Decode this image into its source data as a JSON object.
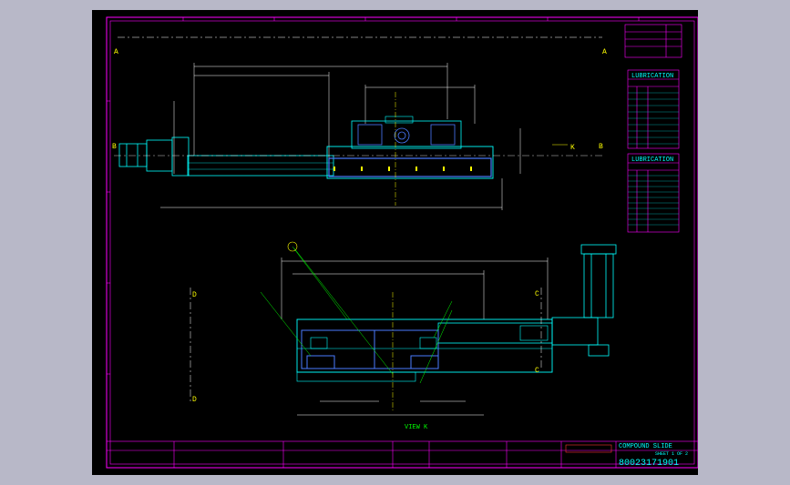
{
  "colors": {
    "background": "#b8b8c8",
    "sheet": "#000000",
    "border": "#ff00ff",
    "object": "#00ffff",
    "dimension": "#ffffff",
    "centerline": "#ffff00",
    "callout": "#00ff00",
    "note": "#ff5555"
  },
  "title_block": {
    "drawing_title": "COMPOUND SLIDE",
    "drawing_number": "80023171901",
    "sheet": "SHEET 1 OF 2"
  },
  "view_labels": {
    "section_a_left": "A",
    "section_a_right": "A",
    "section_b_left": "B",
    "section_b_right": "B",
    "view_k": "K",
    "view_k_caption": "VIEW K",
    "section_c_top": "C",
    "section_c_bottom": "C",
    "section_d_top": "D",
    "section_d_bottom": "D"
  },
  "lubrication_tables": [
    {
      "title": "LUBRICATION",
      "rows": 10
    },
    {
      "title": "LUBRICATION",
      "rows": 12
    }
  ],
  "icons": [
    "datum-circle-icon",
    "section-arrow-icon"
  ]
}
